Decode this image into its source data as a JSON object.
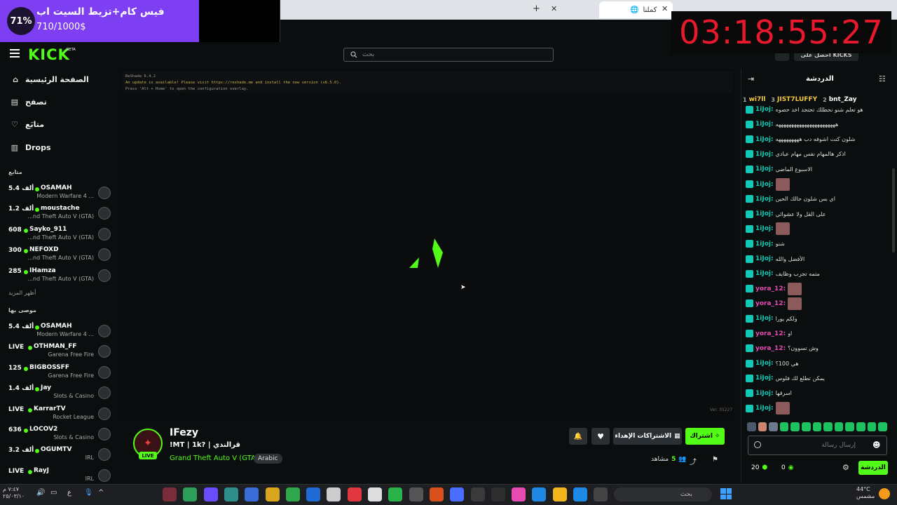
{
  "browser": {
    "active_tab_title": "كملنا",
    "new_tab_symbol": "+",
    "close_symbol": "✕"
  },
  "goal_overlay": {
    "percent": "71%",
    "title": "فيس كام+تزيط السيت اب",
    "amount": "710/1000$"
  },
  "timer_overlay": {
    "value": "03:18:55:27"
  },
  "header": {
    "logo": "KICK",
    "logo_badge": "BETA",
    "search_placeholder": "بحث",
    "kicks_button": "احصل على KICKS"
  },
  "sidebar": {
    "nav": [
      {
        "label": "الصفحة الرئيسية",
        "icon": "home-icon"
      },
      {
        "label": "تصفح",
        "icon": "browse-icon"
      },
      {
        "label": "متابَع",
        "icon": "heart-icon"
      },
      {
        "label": "Drops",
        "icon": "drops-icon"
      }
    ],
    "following_title": "متابع",
    "following": [
      {
        "viewers": "5.4 ألف",
        "name": "OSAMAH",
        "category": "Modern Warfare 4 ..."
      },
      {
        "viewers": "1.2 ألف",
        "name": "moustache",
        "category": "...nd Theft Auto V (GTA)"
      },
      {
        "viewers": "608",
        "name": "Sayko_911",
        "category": "...nd Theft Auto V (GTA)"
      },
      {
        "viewers": "300",
        "name": "NEFOXD",
        "category": "...nd Theft Auto V (GTA)"
      },
      {
        "viewers": "285",
        "name": "IHamza",
        "category": "...nd Theft Auto V (GTA)"
      }
    ],
    "show_more": "أظهر المزيد",
    "recommended_title": "موصى بها",
    "recommended": [
      {
        "viewers": "5.4 ألف",
        "name": "OSAMAH",
        "category": "Modern Warfare 4 ..."
      },
      {
        "viewers": "LIVE",
        "name": "OTHMAN_FF",
        "category": "Garena Free Fire"
      },
      {
        "viewers": "125",
        "name": "BIGBOSSFF",
        "category": "Garena Free Fire"
      },
      {
        "viewers": "1.4 ألف",
        "name": "Jay",
        "category": "Slots & Casino"
      },
      {
        "viewers": "LIVE",
        "name": "KarrarTV",
        "category": "Rocket League"
      },
      {
        "viewers": "636",
        "name": "LOCOV2",
        "category": "Slots & Casino"
      },
      {
        "viewers": "3.2 ألف",
        "name": "OGUMTV",
        "category": "IRL"
      },
      {
        "viewers": "LIVE",
        "name": "RayJ",
        "category": "IRL"
      }
    ]
  },
  "player": {
    "reshade_line1": "ReShade 6.4.2",
    "reshade_line2": "An update is available! Please visit https://reshade.me and install the new version (v6.5.0).",
    "reshade_line3": "Press 'Alt + Home' to open the configuration overlay.",
    "version": "Ver. 35227"
  },
  "stream": {
    "streamer": "IFezy",
    "live_badge": "LIVE",
    "title": "!MT | 1k? | قرالندي",
    "category": "Grand Theft Auto V (GTA)",
    "language": "Arabic",
    "follow_label": "اشتراك",
    "gift_label": "الاشتراكات الإهداء",
    "viewers_label": "مشاهد",
    "viewers_count": "5"
  },
  "chat": {
    "title": "الدردشة",
    "pinned": [
      {
        "name": "bnt_Zay",
        "n": "2"
      },
      {
        "name": "JIST7LUFFY",
        "n": "3"
      },
      {
        "name": "wi7ll",
        "n": "1"
      }
    ],
    "messages": [
      {
        "user": "1iJoj:",
        "text": "هو تعلم شنو نحطلك تحتجد اخد حصوه",
        "color": "#10c9b6",
        "emote": false
      },
      {
        "user": "1iJoj:",
        "text": "هههههههههههههههههههههههه",
        "color": "#10c9b6",
        "emote": false
      },
      {
        "user": "1iJoj:",
        "text": "شلون كنت اشوفه دب هههههههههه",
        "color": "#10c9b6",
        "emote": false
      },
      {
        "user": "1iJoj:",
        "text": "اذكر هالمهام نفس مهام عبادي",
        "color": "#10c9b6",
        "emote": false
      },
      {
        "user": "1iJoj:",
        "text": "الاسبوع الماضي",
        "color": "#10c9b6",
        "emote": false
      },
      {
        "user": "1iJoj:",
        "text": "",
        "color": "#10c9b6",
        "emote": true
      },
      {
        "user": "1iJoj:",
        "text": "اي بس شلون حالك الحين",
        "color": "#10c9b6",
        "emote": false
      },
      {
        "user": "1iJoj:",
        "text": "على القل ولا عشوائي",
        "color": "#10c9b6",
        "emote": false
      },
      {
        "user": "1iJoj:",
        "text": "",
        "color": "#10c9b6",
        "emote": true
      },
      {
        "user": "1iJoj:",
        "text": "شنو",
        "color": "#10c9b6",
        "emote": false
      },
      {
        "user": "1iJoj:",
        "text": "الأفضل والله",
        "color": "#10c9b6",
        "emote": false
      },
      {
        "user": "1iJoj:",
        "text": "متمه تجرب وظايف",
        "color": "#10c9b6",
        "emote": false
      },
      {
        "user": "yora_12:",
        "text": "",
        "color": "#e64ab3",
        "emote": true
      },
      {
        "user": "yora_12:",
        "text": "",
        "color": "#e64ab3",
        "emote": true
      },
      {
        "user": "1iJoj:",
        "text": "ولكم يورا",
        "color": "#10c9b6",
        "emote": false
      },
      {
        "user": "yora_12:",
        "text": "او",
        "color": "#e64ab3",
        "emote": false
      },
      {
        "user": "yora_12:",
        "text": "وش تسوون؟",
        "color": "#e64ab3",
        "emote": false
      },
      {
        "user": "1iJoj:",
        "text": "هي 100؟",
        "color": "#10c9b6",
        "emote": false
      },
      {
        "user": "1iJoj:",
        "text": "يمكن تطلع لك فلوس",
        "color": "#10c9b6",
        "emote": false
      },
      {
        "user": "1iJoj:",
        "text": "اسرقها",
        "color": "#10c9b6",
        "emote": false
      },
      {
        "user": "1iJoj:",
        "text": "",
        "color": "#10c9b6",
        "emote": true
      }
    ],
    "input_placeholder": "إرسال رسالة",
    "send_label": "الدردشة",
    "points_a": "0",
    "points_b": "20"
  },
  "taskbar": {
    "search_placeholder": "بحث",
    "clock_time": "٧:٤٧ م",
    "clock_date": "٢٥/٠٣/١٠",
    "weather_temp": "44°C",
    "weather_desc": "مشمس",
    "lang": "ع"
  }
}
